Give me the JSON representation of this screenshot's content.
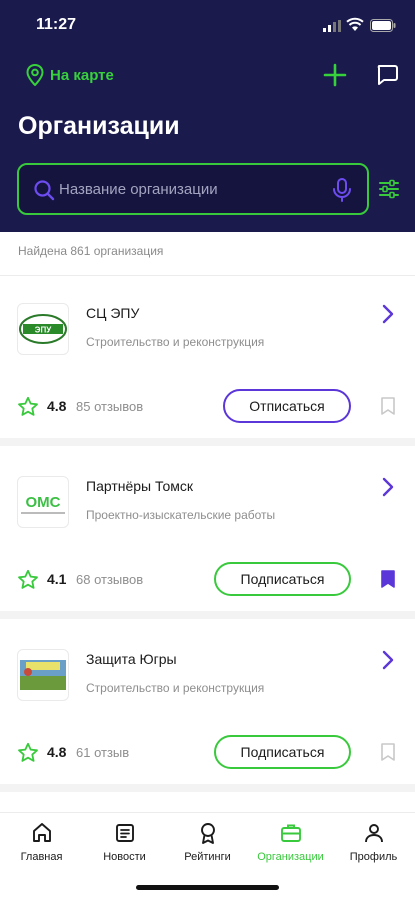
{
  "status_bar": {
    "time": "11:27"
  },
  "header": {
    "map_link": "На карте",
    "title": "Организации"
  },
  "search": {
    "placeholder": "Название организации"
  },
  "found_text": "Найдена 861 организация",
  "organizations": [
    {
      "name": "СЦ ЭПУ",
      "category": "Строительство и реконструкция",
      "rating": "4.8",
      "reviews": "85 отзывов",
      "action": "Отписаться",
      "bookmarked": false,
      "logo_text": "ЭПУ"
    },
    {
      "name": "Партнёры Томск",
      "category": "Проектно-изыскательские работы",
      "rating": "4.1",
      "reviews": "68 отзывов",
      "action": "Подписаться",
      "bookmarked": true,
      "logo_text": "ОМС"
    },
    {
      "name": "Защита Югры",
      "category": "Строительство и реконструкция",
      "rating": "4.8",
      "reviews": "61 отзыв",
      "action": "Подписаться",
      "bookmarked": false,
      "logo_text": ""
    }
  ],
  "tabs": [
    {
      "label": "Главная",
      "icon": "home-icon",
      "active": false
    },
    {
      "label": "Новости",
      "icon": "news-icon",
      "active": false
    },
    {
      "label": "Рейтинги",
      "icon": "medal-icon",
      "active": false
    },
    {
      "label": "Организации",
      "icon": "briefcase-icon",
      "active": true
    },
    {
      "label": "Профиль",
      "icon": "profile-icon",
      "active": false
    }
  ],
  "colors": {
    "header_bg": "#1a1a4d",
    "accent_green": "#39c93c",
    "accent_purple": "#5b36d8"
  }
}
